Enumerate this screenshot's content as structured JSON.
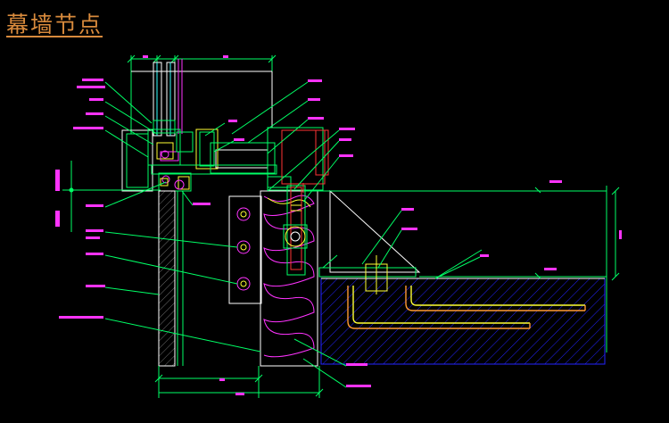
{
  "drawing": {
    "title": "幕墙节点",
    "colors": {
      "background": "#000000",
      "title": "#d88a3c",
      "leader": "#00ff66",
      "dimension": "#00ff66",
      "outline": "#ffffff",
      "magenta": "#ff33ff",
      "yellow": "#ffff33",
      "red": "#ff3333",
      "cyan": "#33ffff",
      "blue_hatch": "#2222ff",
      "orange": "#ff9933"
    }
  }
}
